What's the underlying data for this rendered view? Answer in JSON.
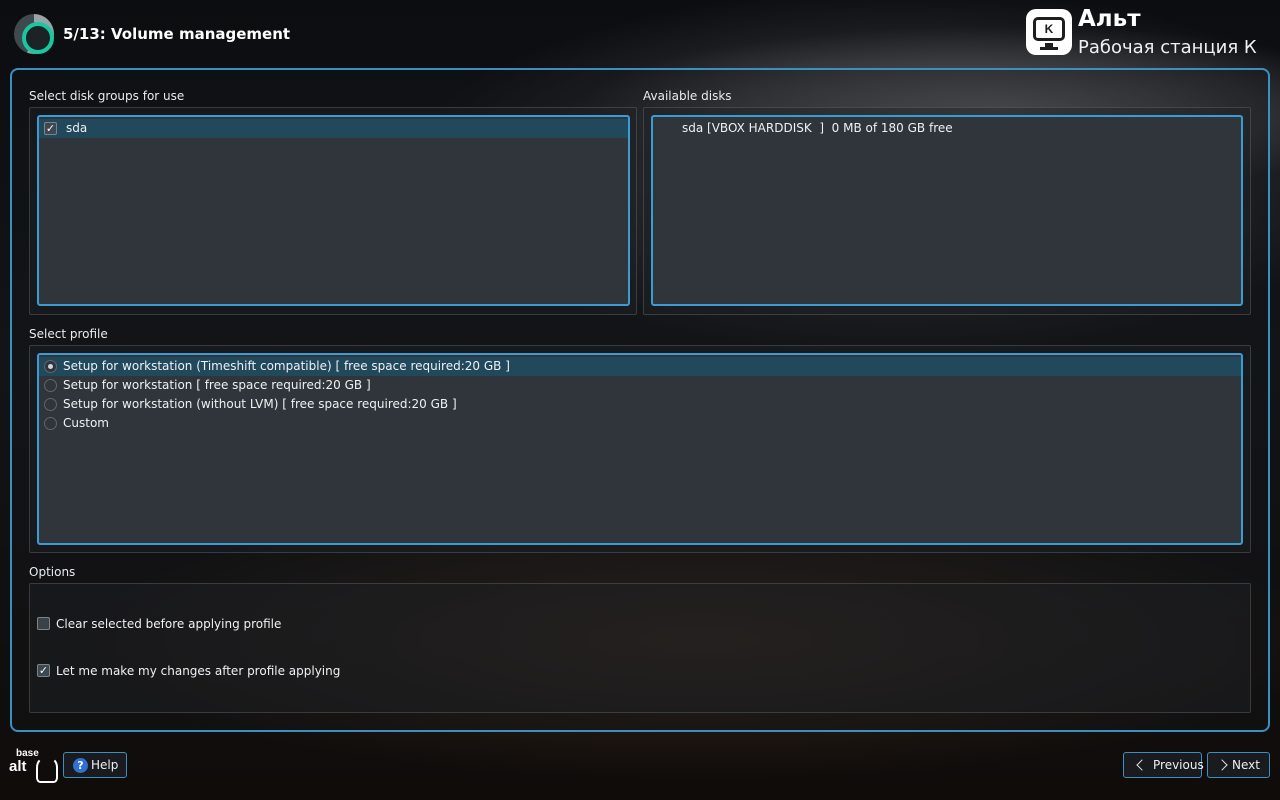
{
  "header": {
    "step_title": "5/13: Volume management",
    "brand_name": "Альт",
    "brand_subtitle": "Рабочая станция К",
    "brand_icon_letter": "K"
  },
  "disk_groups": {
    "label": "Select disk groups for use",
    "items": [
      {
        "name": "sda",
        "checked": true,
        "selected": true
      }
    ]
  },
  "available_disks": {
    "label": "Available disks",
    "items": [
      {
        "text": "sda [VBOX HARDDISK  ]  0 MB of 180 GB free"
      }
    ]
  },
  "profile": {
    "label": "Select profile",
    "options": [
      {
        "label": "Setup for workstation (Timeshift compatible) [ free space required:20 GB ]",
        "selected": true
      },
      {
        "label": "Setup for workstation [ free space required:20 GB ]",
        "selected": false
      },
      {
        "label": "Setup for workstation (without LVM) [ free space required:20 GB ]",
        "selected": false
      },
      {
        "label": "Custom",
        "selected": false
      }
    ]
  },
  "options": {
    "label": "Options",
    "items": [
      {
        "label": "Clear selected before applying profile",
        "checked": false
      },
      {
        "label": "Let me make my changes after profile applying",
        "checked": true
      }
    ]
  },
  "footer": {
    "logo_line1": "base",
    "logo_line2": "alt",
    "help_label": "Help",
    "help_icon": "?",
    "previous_label": "Previous",
    "next_label": "Next"
  },
  "colors": {
    "accent": "#3d9bd4",
    "selection": "#22485c",
    "list_bg": "#2f353a"
  }
}
